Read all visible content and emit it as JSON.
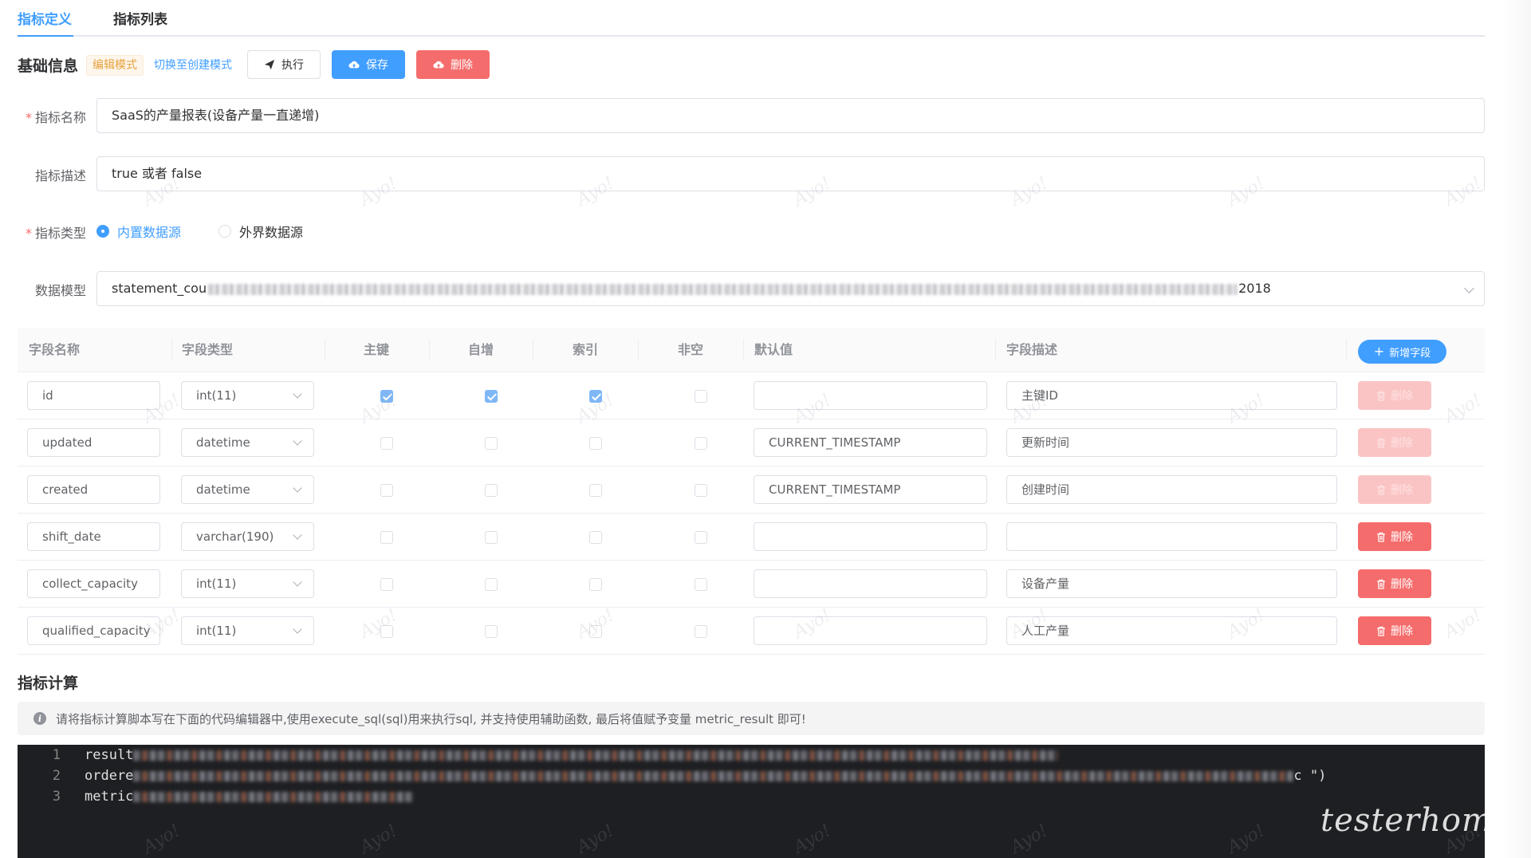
{
  "tabs": [
    {
      "label": "指标定义",
      "active": true
    },
    {
      "label": "指标列表",
      "active": false
    }
  ],
  "basic": {
    "title": "基础信息",
    "mode_tag": "编辑模式",
    "switch_link": "切换至创建模式",
    "exec_label": "执行",
    "save_label": "保存",
    "delete_label": "删除"
  },
  "form": {
    "name_label": "指标名称",
    "name_value": "SaaS的产量报表(设备产量一直递增)",
    "desc_label": "指标描述",
    "desc_value": "true 或者 false",
    "type_label": "指标类型",
    "type_options": [
      "内置数据源",
      "外界数据源"
    ],
    "type_selected": "内置数据源",
    "model_label": "数据模型",
    "model_value_start": "statement_cou",
    "model_value_end": "2018"
  },
  "table": {
    "headers": [
      "字段名称",
      "字段类型",
      "主键",
      "自增",
      "索引",
      "非空",
      "默认值",
      "字段描述"
    ],
    "add_field_label": "新增字段",
    "delete_label": "删除",
    "rows": [
      {
        "name": "id",
        "type": "int(11)",
        "pk": true,
        "ai": true,
        "idx": true,
        "nn": false,
        "default": "",
        "desc": "主键ID",
        "deletable": false
      },
      {
        "name": "updated",
        "type": "datetime",
        "pk": false,
        "ai": false,
        "idx": false,
        "nn": false,
        "default": "CURRENT_TIMESTAMP",
        "desc": "更新时间",
        "deletable": false
      },
      {
        "name": "created",
        "type": "datetime",
        "pk": false,
        "ai": false,
        "idx": false,
        "nn": false,
        "default": "CURRENT_TIMESTAMP",
        "desc": "创建时间",
        "deletable": false
      },
      {
        "name": "shift_date",
        "type": "varchar(190)",
        "pk": false,
        "ai": false,
        "idx": false,
        "nn": false,
        "default": "",
        "desc": "",
        "deletable": true
      },
      {
        "name": "collect_capacity",
        "type": "int(11)",
        "pk": false,
        "ai": false,
        "idx": false,
        "nn": false,
        "default": "",
        "desc": "设备产量",
        "deletable": true
      },
      {
        "name": "qualified_capacity",
        "type": "int(11)",
        "pk": false,
        "ai": false,
        "idx": false,
        "nn": false,
        "default": "",
        "desc": "人工产量",
        "deletable": true
      }
    ]
  },
  "calc": {
    "title": "指标计算",
    "tip": "请将指标计算脚本写在下面的代码编辑器中,使用execute_sql(sql)用来执行sql, 并支持使用辅助函数, 最后将值赋予变量 metric_result 即可!"
  },
  "editor": {
    "lines": [
      {
        "num": "1",
        "text": "result",
        "tail": ""
      },
      {
        "num": "2",
        "text": "ordere",
        "tail": "c \")"
      },
      {
        "num": "3",
        "text": "metric",
        "tail": ""
      }
    ]
  },
  "watermark": "Ayo!",
  "brand_watermark": "testerhome.com"
}
